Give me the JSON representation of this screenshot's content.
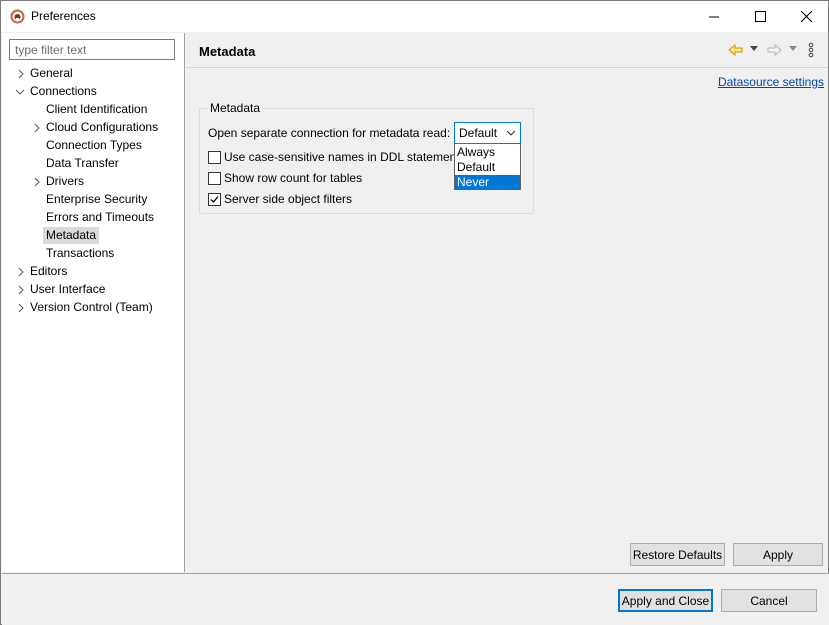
{
  "window": {
    "title": "Preferences",
    "app_icon": "dbeaver-beaver-icon",
    "controls": [
      "minimize-icon",
      "maximize-icon",
      "close-icon"
    ]
  },
  "sidebar": {
    "filter_placeholder": "type filter text",
    "items": [
      {
        "label": "General",
        "expandable": true,
        "expanded": false,
        "level": 0
      },
      {
        "label": "Connections",
        "expandable": true,
        "expanded": true,
        "level": 0
      },
      {
        "label": "Client Identification",
        "expandable": false,
        "level": 1
      },
      {
        "label": "Cloud Configurations",
        "expandable": true,
        "expanded": false,
        "level": 1
      },
      {
        "label": "Connection Types",
        "expandable": false,
        "level": 1
      },
      {
        "label": "Data Transfer",
        "expandable": false,
        "level": 1
      },
      {
        "label": "Drivers",
        "expandable": true,
        "expanded": false,
        "level": 1
      },
      {
        "label": "Enterprise Security",
        "expandable": false,
        "level": 1
      },
      {
        "label": "Errors and Timeouts",
        "expandable": false,
        "level": 1
      },
      {
        "label": "Metadata",
        "expandable": false,
        "level": 1,
        "selected": true
      },
      {
        "label": "Transactions",
        "expandable": false,
        "level": 1
      },
      {
        "label": "Editors",
        "expandable": true,
        "expanded": false,
        "level": 0
      },
      {
        "label": "User Interface",
        "expandable": true,
        "expanded": false,
        "level": 0
      },
      {
        "label": "Version Control (Team)",
        "expandable": true,
        "expanded": false,
        "level": 0
      }
    ]
  },
  "main": {
    "title": "Metadata",
    "nav_icons": [
      "back-arrow-icon",
      "back-dropdown-icon",
      "forward-arrow-icon",
      "forward-dropdown-icon",
      "view-menu-icon"
    ],
    "datasource_link": "Datasource settings",
    "group": {
      "legend": "Metadata",
      "metadata_read_label": "Open separate connection for metadata read:",
      "metadata_read_value": "Default",
      "metadata_read_options": [
        "Always",
        "Default",
        "Never"
      ],
      "highlighted_option": "Never",
      "checkboxes": [
        {
          "label": "Use case-sensitive names in DDL statements",
          "checked": false
        },
        {
          "label": "Show row count for tables",
          "checked": false
        },
        {
          "label": "Server side object filters",
          "checked": true
        }
      ]
    },
    "restore_defaults_label": "Restore Defaults",
    "apply_label": "Apply"
  },
  "footer": {
    "apply_close_label": "Apply and Close",
    "cancel_label": "Cancel"
  },
  "colors": {
    "accent": "#0078d7",
    "link": "#0645ad",
    "selection": "#d9d9d9"
  }
}
